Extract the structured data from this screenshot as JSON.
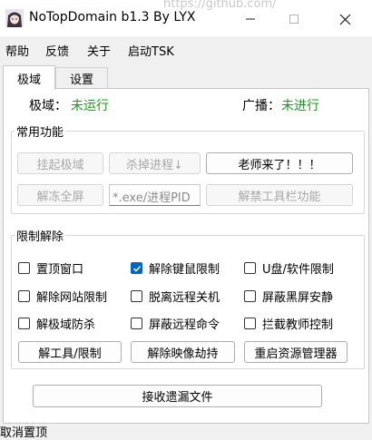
{
  "window": {
    "title": "NoTopDomain b1.3 By LYX",
    "background_text": "https://github.com/"
  },
  "menu": [
    "帮助",
    "反馈",
    "关于",
    "启动TSK"
  ],
  "tabs": [
    {
      "label": "极域",
      "active": true
    },
    {
      "label": "设置",
      "active": false
    }
  ],
  "status_row": {
    "jiyu_label": "极域：",
    "jiyu_value": "未运行",
    "broadcast_label": "广播：",
    "broadcast_value": "未进行",
    "value_color": "#1a9a1a"
  },
  "common_group": {
    "title": "常用功能",
    "btn_hang": "挂起极域",
    "btn_kill": "杀掉进程↓",
    "btn_teacher": "老师来了！！！",
    "btn_unfreeze": "解冻全屏",
    "input_placeholder": "*.exe/进程PID",
    "btn_unlock_toolbar": "解禁工具栏功能"
  },
  "limit_group": {
    "title": "限制解除",
    "checkboxes": [
      {
        "label": "置顶窗口",
        "checked": false
      },
      {
        "label": "解除键鼠限制",
        "checked": true
      },
      {
        "label": "U盘/软件限制",
        "checked": false
      },
      {
        "label": "解除网站限制",
        "checked": false
      },
      {
        "label": "脱离远程关机",
        "checked": false
      },
      {
        "label": "屏蔽黑屏安静",
        "checked": false
      },
      {
        "label": "解极域防杀",
        "checked": false
      },
      {
        "label": "屏蔽远程命令",
        "checked": false
      },
      {
        "label": "拦截教师控制",
        "checked": false
      }
    ],
    "btn_tools": "解工具/限制",
    "btn_image": "解除映像劫持",
    "btn_restart": "重启资源管理器"
  },
  "receive_button": "接收遗漏文件",
  "footer_status": "取消置顶",
  "accent_color": "#0067c0",
  "icons": {
    "app": "anime-avatar-icon",
    "minimize": "minimize-icon",
    "maximize": "maximize-icon",
    "close": "close-icon",
    "checkmark": "checkmark-icon"
  }
}
